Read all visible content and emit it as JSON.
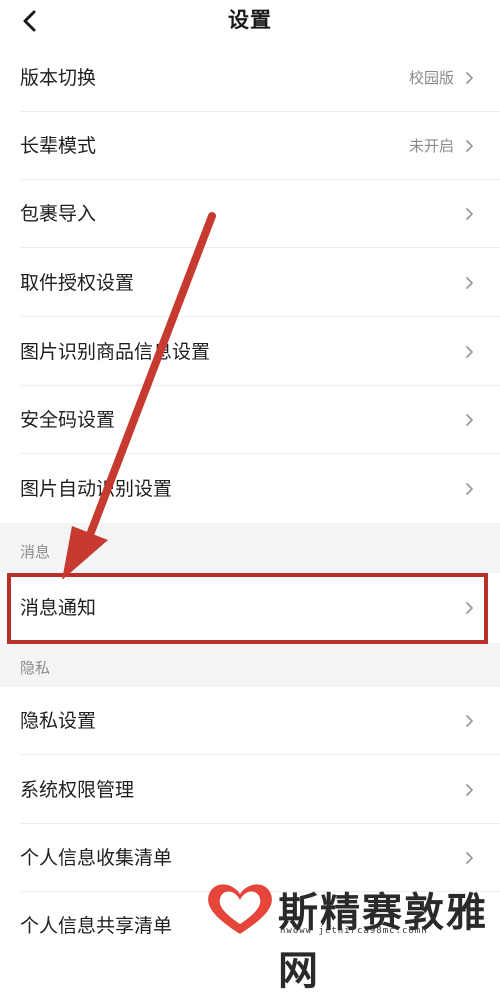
{
  "header": {
    "title": "设置"
  },
  "settings": [
    {
      "label": "版本切换",
      "value": "校园版"
    },
    {
      "label": "长辈模式",
      "value": "未开启"
    },
    {
      "label": "包裹导入",
      "value": ""
    },
    {
      "label": "取件授权设置",
      "value": ""
    },
    {
      "label": "图片识别商品信息设置",
      "value": ""
    },
    {
      "label": "安全码设置",
      "value": ""
    },
    {
      "label": "图片自动识别设置",
      "value": ""
    }
  ],
  "sections": {
    "messages": {
      "title": "消息",
      "items": [
        {
          "label": "消息通知"
        }
      ]
    },
    "privacy": {
      "title": "隐私",
      "items": [
        {
          "label": "隐私设置"
        },
        {
          "label": "系统权限管理"
        },
        {
          "label": "个人信息收集清单"
        },
        {
          "label": "个人信息共享清单"
        }
      ]
    }
  },
  "watermark": {
    "text": "斯精赛敦雅网",
    "url": "nwoww jcthirca98mc.comn"
  },
  "colors": {
    "annotation_red": "#b8302a",
    "section_bg": "#f3f4f6"
  }
}
